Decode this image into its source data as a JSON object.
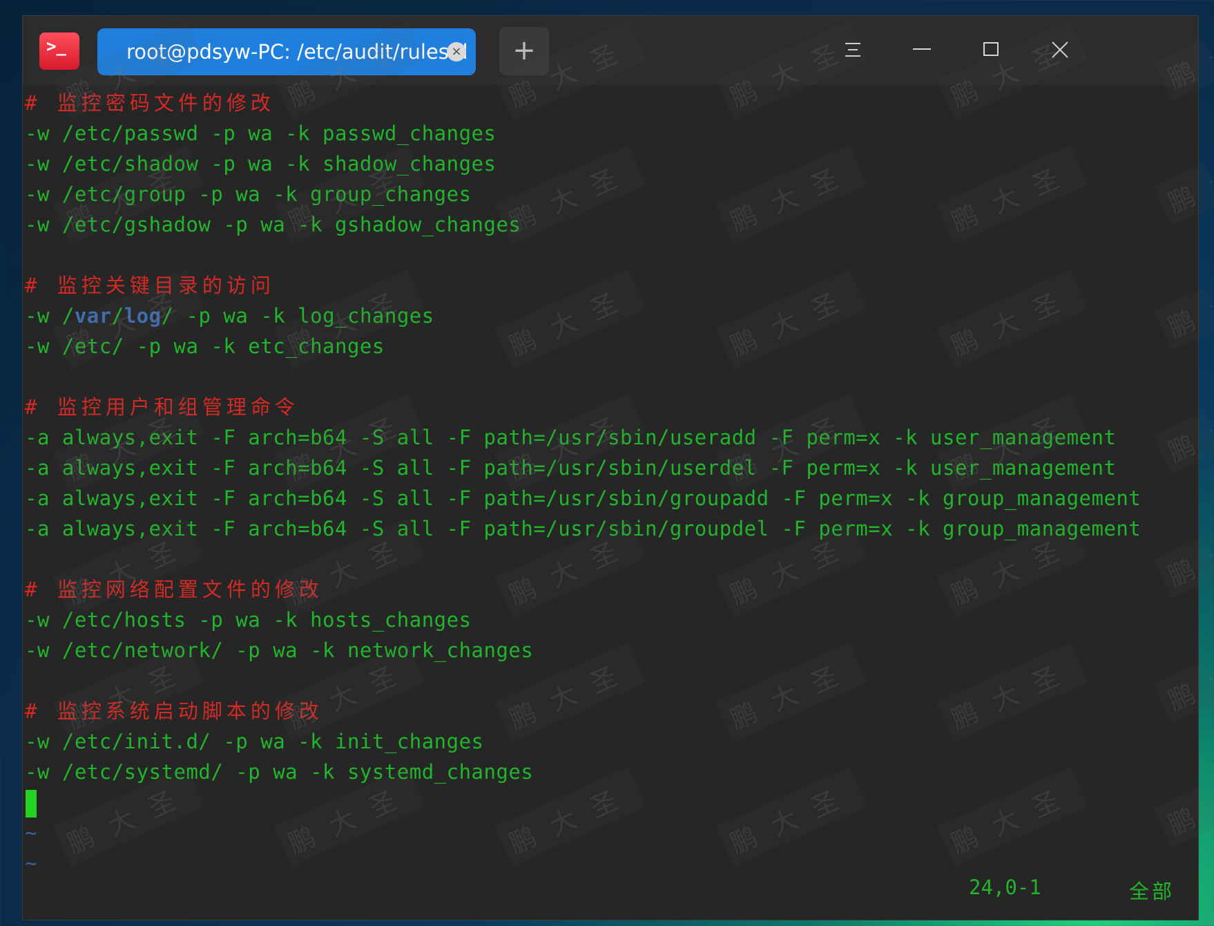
{
  "window": {
    "tab_title": "root@pdsyw-PC: /etc/audit/rules.d",
    "tab_close_glyph": "×",
    "new_tab_glyph": "+",
    "app_icon_glyph": ">_"
  },
  "editor": {
    "lines": [
      {
        "type": "comment",
        "text": "# 监控密码文件的修改"
      },
      {
        "type": "cmd",
        "text": "-w /etc/passwd -p wa -k passwd_changes"
      },
      {
        "type": "cmd",
        "text": "-w /etc/shadow -p wa -k shadow_changes"
      },
      {
        "type": "cmd",
        "text": "-w /etc/group -p wa -k group_changes"
      },
      {
        "type": "cmd",
        "text": "-w /etc/gshadow -p wa -k gshadow_changes"
      },
      {
        "type": "blank",
        "text": ""
      },
      {
        "type": "comment",
        "text": "# 监控关键目录的访问"
      },
      {
        "type": "cmd_hl",
        "pre": "-w /",
        "hl1": "var",
        "mid": "/",
        "hl2": "log",
        "post": "/ -p wa -k log_changes"
      },
      {
        "type": "cmd",
        "text": "-w /etc/ -p wa -k etc_changes"
      },
      {
        "type": "blank",
        "text": ""
      },
      {
        "type": "comment",
        "text": "# 监控用户和组管理命令"
      },
      {
        "type": "cmd",
        "text": "-a always,exit -F arch=b64 -S all -F path=/usr/sbin/useradd -F perm=x -k user_management"
      },
      {
        "type": "cmd",
        "text": "-a always,exit -F arch=b64 -S all -F path=/usr/sbin/userdel -F perm=x -k user_management"
      },
      {
        "type": "cmd",
        "text": "-a always,exit -F arch=b64 -S all -F path=/usr/sbin/groupadd -F perm=x -k group_management"
      },
      {
        "type": "cmd",
        "text": "-a always,exit -F arch=b64 -S all -F path=/usr/sbin/groupdel -F perm=x -k group_management"
      },
      {
        "type": "blank",
        "text": ""
      },
      {
        "type": "comment",
        "text": "# 监控网络配置文件的修改"
      },
      {
        "type": "cmd",
        "text": "-w /etc/hosts -p wa -k hosts_changes"
      },
      {
        "type": "cmd",
        "text": "-w /etc/network/ -p wa -k network_changes"
      },
      {
        "type": "blank",
        "text": ""
      },
      {
        "type": "comment",
        "text": "# 监控系统启动脚本的修改"
      },
      {
        "type": "cmd",
        "text": "-w /etc/init.d/ -p wa -k init_changes"
      },
      {
        "type": "cmd",
        "text": "-w /etc/systemd/ -p wa -k systemd_changes"
      },
      {
        "type": "cursor",
        "text": ""
      },
      {
        "type": "tilde",
        "text": "~"
      },
      {
        "type": "tilde",
        "text": "~"
      }
    ]
  },
  "status": {
    "position": "24,0-1",
    "view": "全部"
  },
  "watermark_text": "鹏大圣",
  "colors": {
    "command": "#21b52b",
    "comment": "#d42a24",
    "highlight": "#3f6fb4",
    "tab": "#1f7fde",
    "cursor": "#22d322"
  }
}
